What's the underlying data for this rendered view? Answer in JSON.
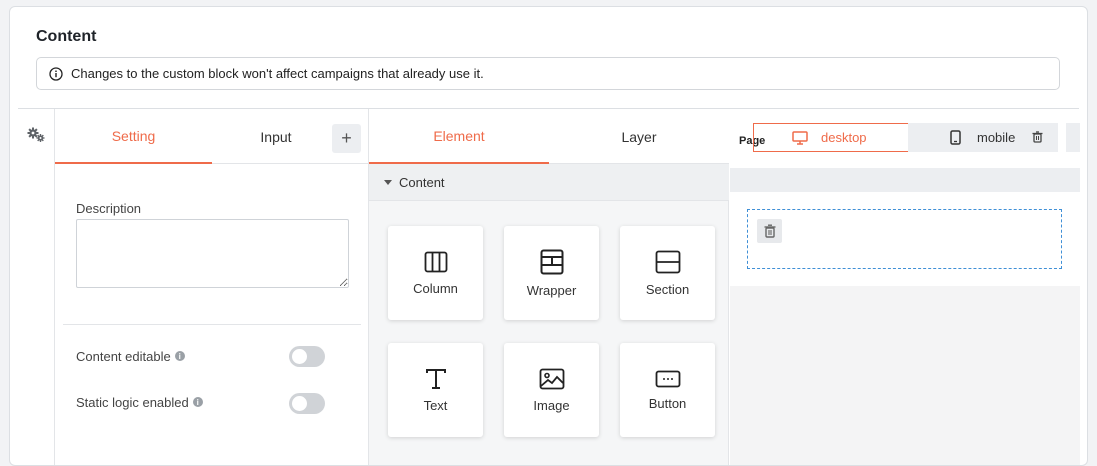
{
  "header": {
    "title": "Content",
    "notice": "Changes to the custom block won't affect campaigns that already use it."
  },
  "rail": {
    "icon": "gears-icon"
  },
  "settings": {
    "tabs": [
      {
        "label": "Setting",
        "active": true
      },
      {
        "label": "Input",
        "active": false
      }
    ],
    "add_label": "+",
    "description_label": "Description",
    "description_value": "",
    "options": [
      {
        "label": "Content editable",
        "enabled": false
      },
      {
        "label": "Static logic enabled",
        "enabled": false
      }
    ]
  },
  "elements": {
    "tabs": [
      {
        "label": "Element",
        "active": true
      },
      {
        "label": "Layer",
        "active": false
      }
    ],
    "section_title": "Content",
    "items": [
      {
        "label": "Column",
        "icon": "column-icon"
      },
      {
        "label": "Wrapper",
        "icon": "wrapper-icon"
      },
      {
        "label": "Section",
        "icon": "section-icon"
      },
      {
        "label": "Text",
        "icon": "text-icon"
      },
      {
        "label": "Image",
        "icon": "image-icon"
      },
      {
        "label": "Button",
        "icon": "button-icon"
      }
    ]
  },
  "preview": {
    "page_label": "Page",
    "devices": [
      {
        "label": "desktop",
        "active": true
      },
      {
        "label": "mobile",
        "active": false
      }
    ]
  },
  "colors": {
    "accent": "#ef6b4a",
    "dropzone_border": "#3f8fd6"
  }
}
